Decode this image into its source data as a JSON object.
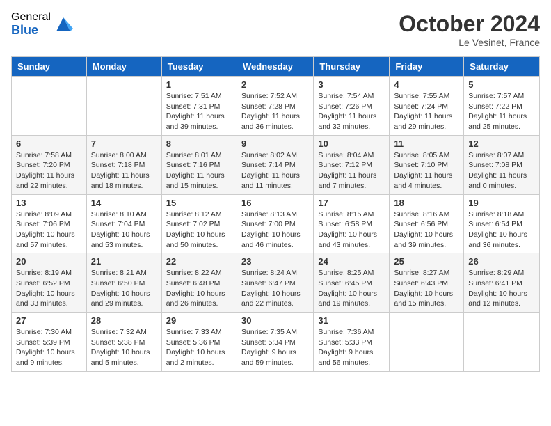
{
  "logo": {
    "general": "General",
    "blue": "Blue"
  },
  "title": "October 2024",
  "location": "Le Vesinet, France",
  "days_header": [
    "Sunday",
    "Monday",
    "Tuesday",
    "Wednesday",
    "Thursday",
    "Friday",
    "Saturday"
  ],
  "weeks": [
    [
      {
        "day": "",
        "info": ""
      },
      {
        "day": "",
        "info": ""
      },
      {
        "day": "1",
        "info": "Sunrise: 7:51 AM\nSunset: 7:31 PM\nDaylight: 11 hours and 39 minutes."
      },
      {
        "day": "2",
        "info": "Sunrise: 7:52 AM\nSunset: 7:28 PM\nDaylight: 11 hours and 36 minutes."
      },
      {
        "day": "3",
        "info": "Sunrise: 7:54 AM\nSunset: 7:26 PM\nDaylight: 11 hours and 32 minutes."
      },
      {
        "day": "4",
        "info": "Sunrise: 7:55 AM\nSunset: 7:24 PM\nDaylight: 11 hours and 29 minutes."
      },
      {
        "day": "5",
        "info": "Sunrise: 7:57 AM\nSunset: 7:22 PM\nDaylight: 11 hours and 25 minutes."
      }
    ],
    [
      {
        "day": "6",
        "info": "Sunrise: 7:58 AM\nSunset: 7:20 PM\nDaylight: 11 hours and 22 minutes."
      },
      {
        "day": "7",
        "info": "Sunrise: 8:00 AM\nSunset: 7:18 PM\nDaylight: 11 hours and 18 minutes."
      },
      {
        "day": "8",
        "info": "Sunrise: 8:01 AM\nSunset: 7:16 PM\nDaylight: 11 hours and 15 minutes."
      },
      {
        "day": "9",
        "info": "Sunrise: 8:02 AM\nSunset: 7:14 PM\nDaylight: 11 hours and 11 minutes."
      },
      {
        "day": "10",
        "info": "Sunrise: 8:04 AM\nSunset: 7:12 PM\nDaylight: 11 hours and 7 minutes."
      },
      {
        "day": "11",
        "info": "Sunrise: 8:05 AM\nSunset: 7:10 PM\nDaylight: 11 hours and 4 minutes."
      },
      {
        "day": "12",
        "info": "Sunrise: 8:07 AM\nSunset: 7:08 PM\nDaylight: 11 hours and 0 minutes."
      }
    ],
    [
      {
        "day": "13",
        "info": "Sunrise: 8:09 AM\nSunset: 7:06 PM\nDaylight: 10 hours and 57 minutes."
      },
      {
        "day": "14",
        "info": "Sunrise: 8:10 AM\nSunset: 7:04 PM\nDaylight: 10 hours and 53 minutes."
      },
      {
        "day": "15",
        "info": "Sunrise: 8:12 AM\nSunset: 7:02 PM\nDaylight: 10 hours and 50 minutes."
      },
      {
        "day": "16",
        "info": "Sunrise: 8:13 AM\nSunset: 7:00 PM\nDaylight: 10 hours and 46 minutes."
      },
      {
        "day": "17",
        "info": "Sunrise: 8:15 AM\nSunset: 6:58 PM\nDaylight: 10 hours and 43 minutes."
      },
      {
        "day": "18",
        "info": "Sunrise: 8:16 AM\nSunset: 6:56 PM\nDaylight: 10 hours and 39 minutes."
      },
      {
        "day": "19",
        "info": "Sunrise: 8:18 AM\nSunset: 6:54 PM\nDaylight: 10 hours and 36 minutes."
      }
    ],
    [
      {
        "day": "20",
        "info": "Sunrise: 8:19 AM\nSunset: 6:52 PM\nDaylight: 10 hours and 33 minutes."
      },
      {
        "day": "21",
        "info": "Sunrise: 8:21 AM\nSunset: 6:50 PM\nDaylight: 10 hours and 29 minutes."
      },
      {
        "day": "22",
        "info": "Sunrise: 8:22 AM\nSunset: 6:48 PM\nDaylight: 10 hours and 26 minutes."
      },
      {
        "day": "23",
        "info": "Sunrise: 8:24 AM\nSunset: 6:47 PM\nDaylight: 10 hours and 22 minutes."
      },
      {
        "day": "24",
        "info": "Sunrise: 8:25 AM\nSunset: 6:45 PM\nDaylight: 10 hours and 19 minutes."
      },
      {
        "day": "25",
        "info": "Sunrise: 8:27 AM\nSunset: 6:43 PM\nDaylight: 10 hours and 15 minutes."
      },
      {
        "day": "26",
        "info": "Sunrise: 8:29 AM\nSunset: 6:41 PM\nDaylight: 10 hours and 12 minutes."
      }
    ],
    [
      {
        "day": "27",
        "info": "Sunrise: 7:30 AM\nSunset: 5:39 PM\nDaylight: 10 hours and 9 minutes."
      },
      {
        "day": "28",
        "info": "Sunrise: 7:32 AM\nSunset: 5:38 PM\nDaylight: 10 hours and 5 minutes."
      },
      {
        "day": "29",
        "info": "Sunrise: 7:33 AM\nSunset: 5:36 PM\nDaylight: 10 hours and 2 minutes."
      },
      {
        "day": "30",
        "info": "Sunrise: 7:35 AM\nSunset: 5:34 PM\nDaylight: 9 hours and 59 minutes."
      },
      {
        "day": "31",
        "info": "Sunrise: 7:36 AM\nSunset: 5:33 PM\nDaylight: 9 hours and 56 minutes."
      },
      {
        "day": "",
        "info": ""
      },
      {
        "day": "",
        "info": ""
      }
    ]
  ]
}
